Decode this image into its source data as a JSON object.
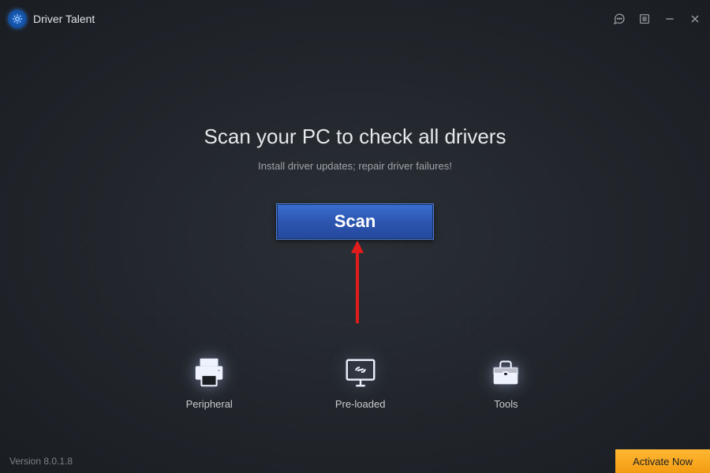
{
  "app": {
    "name": "Driver Talent"
  },
  "titlebar": {
    "feedback_icon": "chat-icon",
    "menu_icon": "list-icon",
    "minimize_icon": "minimize-icon",
    "close_icon": "close-icon"
  },
  "main": {
    "headline": "Scan your PC to check all drivers",
    "subtext": "Install driver updates; repair driver failures!",
    "scan_label": "Scan"
  },
  "features": [
    {
      "label": "Peripheral",
      "icon": "printer-icon"
    },
    {
      "label": "Pre-loaded",
      "icon": "monitor-link-icon"
    },
    {
      "label": "Tools",
      "icon": "toolbox-icon"
    }
  ],
  "footer": {
    "version": "Version 8.0.1.8",
    "activate_label": "Activate Now"
  },
  "annotation": {
    "arrow": "red-up-arrow"
  }
}
